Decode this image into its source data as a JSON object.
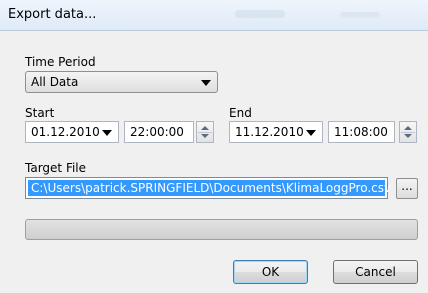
{
  "window": {
    "title": "Export data..."
  },
  "time_period": {
    "label": "Time Period",
    "selected": "All Data"
  },
  "start": {
    "label": "Start",
    "date": "01.12.2010",
    "time": "22:00:00"
  },
  "end": {
    "label": "End",
    "date": "11.12.2010",
    "time": "11:08:00"
  },
  "target_file": {
    "label": "Target File",
    "path": "C:\\Users\\patrick.SPRINGFIELD\\Documents\\KlimaLoggPro.csv",
    "browse_label": "..."
  },
  "progress": {
    "value": 0
  },
  "buttons": {
    "ok": "OK",
    "cancel": "Cancel"
  },
  "colors": {
    "selection": "#3399ff",
    "progress_fill": "#06b025"
  }
}
